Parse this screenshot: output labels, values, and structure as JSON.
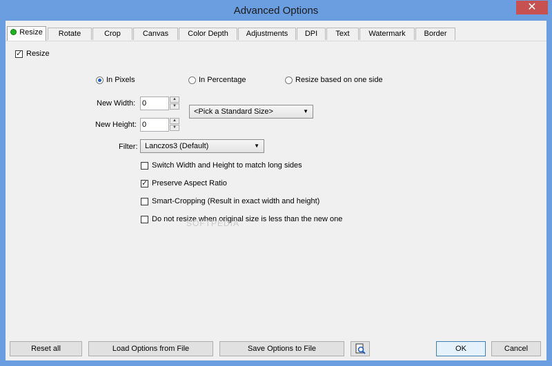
{
  "window": {
    "title": "Advanced Options",
    "close_glyph": "✕"
  },
  "tabs": [
    {
      "label": "Resize",
      "active": true
    },
    {
      "label": "Rotate"
    },
    {
      "label": "Crop"
    },
    {
      "label": "Canvas"
    },
    {
      "label": "Color Depth"
    },
    {
      "label": "Adjustments"
    },
    {
      "label": "DPI"
    },
    {
      "label": "Text"
    },
    {
      "label": "Watermark"
    },
    {
      "label": "Border"
    }
  ],
  "resize": {
    "enable_label": "Resize",
    "enabled": true,
    "mode_options": [
      {
        "label": "In Pixels",
        "selected": true
      },
      {
        "label": "In Percentage",
        "selected": false
      },
      {
        "label": "Resize based on one side",
        "selected": false
      }
    ],
    "new_width_label": "New Width:",
    "new_width_value": "0",
    "new_height_label": "New Height:",
    "new_height_value": "0",
    "standard_size_value": "<Pick a Standard Size>",
    "filter_label": "Filter:",
    "filter_value": "Lanczos3 (Default)",
    "options": [
      {
        "label": "Switch Width and Height to match long sides",
        "checked": false
      },
      {
        "label": "Preserve Aspect Ratio",
        "checked": true
      },
      {
        "label": "Smart-Cropping (Result in exact width and height)",
        "checked": false
      },
      {
        "label": "Do not resize when original size is less than the new one",
        "checked": false
      }
    ]
  },
  "footer": {
    "reset_label": "Reset all",
    "load_label": "Load Options from File",
    "save_label": "Save Options to File",
    "ok_label": "OK",
    "cancel_label": "Cancel"
  },
  "watermark_text": "SOFTPEDIA"
}
